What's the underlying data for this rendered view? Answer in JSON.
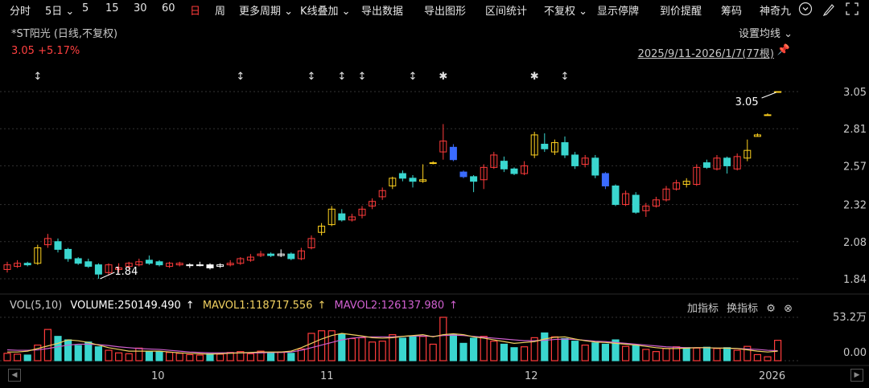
{
  "toolbar": {
    "items": [
      {
        "label": "分时"
      },
      {
        "label": "5日 ⌄"
      },
      {
        "label": "5"
      },
      {
        "label": "15"
      },
      {
        "label": "30"
      },
      {
        "label": "60"
      },
      {
        "label": "日",
        "active": true
      },
      {
        "label": "周"
      },
      {
        "label": "更多周期 ⌄"
      },
      {
        "label": "K线叠加 ⌄"
      },
      {
        "label": "导出数据"
      },
      {
        "label": "导出图形"
      },
      {
        "label": "区间统计"
      },
      {
        "label": "不复权 ⌄"
      },
      {
        "label": "显示停牌"
      },
      {
        "label": "到价提醒"
      },
      {
        "label": "筹码"
      },
      {
        "label": "神奇九"
      }
    ]
  },
  "header": {
    "title": "*ST阳光 (日线,不复权)",
    "price": "3.05 +5.17%",
    "ma_settings": "设置均线 ⌄",
    "range": "2025/9/11-2026/1/7(77根)"
  },
  "price_axis": [
    "3.05",
    "2.81",
    "2.57",
    "2.32",
    "2.08",
    "1.84"
  ],
  "annotations": {
    "high": "3.05",
    "low": "1.84"
  },
  "volume": {
    "name": "VOL(5,10)",
    "volume": "VOLUME:250149.490",
    "mavol1": "MAVOL1:118717.556",
    "mavol2": "MAVOL2:126137.980",
    "buttons": {
      "add": "加指标",
      "switch": "换指标"
    },
    "axis": [
      "53.2万",
      "0.00"
    ]
  },
  "x_labels": [
    "10",
    "11",
    "12",
    "2026"
  ],
  "colors": {
    "up": "#ff3b3b",
    "down": "#3ad6cf",
    "flat": "#ffffff",
    "yellow": "#ffd21f",
    "blue": "#3a6bff",
    "mavol1": "#f0d060",
    "mavol2": "#d060d0",
    "grid": "#333333"
  },
  "markers": [
    "↕",
    "↕",
    "↕",
    "↕",
    "↕",
    "↕",
    "✱",
    "✱",
    "↕"
  ],
  "chart_data": {
    "type": "candlestick",
    "candles": [
      {
        "o": 1.9,
        "c": 1.93,
        "h": 1.95,
        "l": 1.88,
        "v": 0.17
      },
      {
        "o": 1.92,
        "c": 1.94,
        "h": 1.96,
        "l": 1.91,
        "v": 0.15
      },
      {
        "o": 1.94,
        "c": 1.93,
        "h": 1.95,
        "l": 1.92,
        "v": 0.13
      },
      {
        "o": 1.94,
        "c": 2.04,
        "h": 2.06,
        "l": 1.93,
        "v": 0.36
      },
      {
        "o": 2.06,
        "c": 2.1,
        "h": 2.13,
        "l": 2.04,
        "v": 0.72
      },
      {
        "o": 2.08,
        "c": 2.03,
        "h": 2.1,
        "l": 2.01,
        "v": 0.56
      },
      {
        "o": 2.03,
        "c": 1.97,
        "h": 2.04,
        "l": 1.95,
        "v": 0.48
      },
      {
        "o": 1.97,
        "c": 1.94,
        "h": 1.98,
        "l": 1.93,
        "v": 0.35
      },
      {
        "o": 1.95,
        "c": 1.92,
        "h": 1.97,
        "l": 1.91,
        "v": 0.43
      },
      {
        "o": 1.93,
        "c": 1.87,
        "h": 1.94,
        "l": 1.84,
        "v": 0.32
      },
      {
        "o": 1.88,
        "c": 1.93,
        "h": 1.94,
        "l": 1.86,
        "v": 0.24
      },
      {
        "o": 1.9,
        "c": 1.91,
        "h": 1.94,
        "l": 1.88,
        "v": 0.18
      },
      {
        "o": 1.92,
        "c": 1.94,
        "h": 1.95,
        "l": 1.9,
        "v": 0.16
      },
      {
        "o": 1.93,
        "c": 1.95,
        "h": 1.97,
        "l": 1.92,
        "v": 0.29
      },
      {
        "o": 1.96,
        "c": 1.94,
        "h": 1.99,
        "l": 1.93,
        "v": 0.22
      },
      {
        "o": 1.95,
        "c": 1.93,
        "h": 1.96,
        "l": 1.92,
        "v": 0.21
      },
      {
        "o": 1.92,
        "c": 1.94,
        "h": 1.95,
        "l": 1.91,
        "v": 0.19
      },
      {
        "o": 1.93,
        "c": 1.94,
        "h": 1.95,
        "l": 1.92,
        "v": 0.17
      },
      {
        "o": 1.93,
        "c": 1.93,
        "h": 1.94,
        "l": 1.91,
        "v": 0.14
      },
      {
        "o": 1.93,
        "c": 1.93,
        "h": 1.95,
        "l": 1.92,
        "v": 0.13
      },
      {
        "o": 1.93,
        "c": 1.91,
        "h": 1.94,
        "l": 1.9,
        "v": 0.16
      },
      {
        "o": 1.92,
        "c": 1.93,
        "h": 1.94,
        "l": 1.91,
        "v": 0.15
      },
      {
        "o": 1.93,
        "c": 1.94,
        "h": 1.96,
        "l": 1.92,
        "v": 0.19
      },
      {
        "o": 1.94,
        "c": 1.97,
        "h": 1.98,
        "l": 1.93,
        "v": 0.21
      },
      {
        "o": 1.96,
        "c": 1.98,
        "h": 2.0,
        "l": 1.95,
        "v": 0.16
      },
      {
        "o": 1.99,
        "c": 2.0,
        "h": 2.02,
        "l": 1.98,
        "v": 0.22
      },
      {
        "o": 2.0,
        "c": 1.99,
        "h": 2.01,
        "l": 1.98,
        "v": 0.18
      },
      {
        "o": 1.99,
        "c": 2.0,
        "h": 2.03,
        "l": 1.98,
        "v": 0.2
      },
      {
        "o": 2.0,
        "c": 1.97,
        "h": 2.01,
        "l": 1.96,
        "v": 0.17
      },
      {
        "o": 1.97,
        "c": 2.02,
        "h": 2.04,
        "l": 1.96,
        "v": 0.27
      },
      {
        "o": 2.04,
        "c": 2.1,
        "h": 2.12,
        "l": 2.03,
        "v": 0.63
      },
      {
        "o": 2.14,
        "c": 2.18,
        "h": 2.2,
        "l": 2.12,
        "v": 0.69
      },
      {
        "o": 2.19,
        "c": 2.29,
        "h": 2.31,
        "l": 2.18,
        "v": 0.69
      },
      {
        "o": 2.26,
        "c": 2.22,
        "h": 2.29,
        "l": 2.21,
        "v": 0.61
      },
      {
        "o": 2.22,
        "c": 2.24,
        "h": 2.26,
        "l": 2.21,
        "v": 0.51
      },
      {
        "o": 2.25,
        "c": 2.29,
        "h": 2.31,
        "l": 2.23,
        "v": 0.53
      },
      {
        "o": 2.31,
        "c": 2.34,
        "h": 2.36,
        "l": 2.29,
        "v": 0.43
      },
      {
        "o": 2.37,
        "c": 2.41,
        "h": 2.43,
        "l": 2.35,
        "v": 0.45
      },
      {
        "o": 2.44,
        "c": 2.49,
        "h": 2.5,
        "l": 2.42,
        "v": 0.6
      },
      {
        "o": 2.52,
        "c": 2.49,
        "h": 2.54,
        "l": 2.47,
        "v": 0.52
      },
      {
        "o": 2.49,
        "c": 2.47,
        "h": 2.51,
        "l": 2.43,
        "v": 0.57
      },
      {
        "o": 2.47,
        "c": 2.48,
        "h": 2.58,
        "l": 2.46,
        "v": 0.56
      },
      {
        "o": 2.59,
        "c": 2.59,
        "h": 2.6,
        "l": 2.58,
        "v": 0.38
      },
      {
        "o": 2.66,
        "c": 2.73,
        "h": 2.84,
        "l": 2.61,
        "v": 1.0
      },
      {
        "o": 2.69,
        "c": 2.61,
        "h": 2.71,
        "l": 2.6,
        "v": 0.6
      },
      {
        "o": 2.53,
        "c": 2.5,
        "h": 2.54,
        "l": 2.49,
        "v": 0.4
      },
      {
        "o": 2.5,
        "c": 2.47,
        "h": 2.51,
        "l": 2.4,
        "v": 0.52
      },
      {
        "o": 2.48,
        "c": 2.56,
        "h": 2.58,
        "l": 2.42,
        "v": 0.56
      },
      {
        "o": 2.56,
        "c": 2.64,
        "h": 2.66,
        "l": 2.55,
        "v": 0.45
      },
      {
        "o": 2.6,
        "c": 2.55,
        "h": 2.63,
        "l": 2.53,
        "v": 0.38
      },
      {
        "o": 2.55,
        "c": 2.52,
        "h": 2.56,
        "l": 2.51,
        "v": 0.3
      },
      {
        "o": 2.52,
        "c": 2.57,
        "h": 2.6,
        "l": 2.51,
        "v": 0.32
      },
      {
        "o": 2.64,
        "c": 2.77,
        "h": 2.79,
        "l": 2.62,
        "v": 0.53
      },
      {
        "o": 2.71,
        "c": 2.68,
        "h": 2.78,
        "l": 2.66,
        "v": 0.64
      },
      {
        "o": 2.66,
        "c": 2.72,
        "h": 2.74,
        "l": 2.64,
        "v": 0.55
      },
      {
        "o": 2.72,
        "c": 2.64,
        "h": 2.76,
        "l": 2.62,
        "v": 0.51
      },
      {
        "o": 2.64,
        "c": 2.57,
        "h": 2.66,
        "l": 2.55,
        "v": 0.45
      },
      {
        "o": 2.58,
        "c": 2.62,
        "h": 2.64,
        "l": 2.56,
        "v": 0.36
      },
      {
        "o": 2.62,
        "c": 2.51,
        "h": 2.64,
        "l": 2.49,
        "v": 0.41
      },
      {
        "o": 2.52,
        "c": 2.44,
        "h": 2.53,
        "l": 2.42,
        "v": 0.38
      },
      {
        "o": 2.44,
        "c": 2.32,
        "h": 2.45,
        "l": 2.31,
        "v": 0.48
      },
      {
        "o": 2.32,
        "c": 2.39,
        "h": 2.41,
        "l": 2.31,
        "v": 0.33
      },
      {
        "o": 2.38,
        "c": 2.27,
        "h": 2.4,
        "l": 2.26,
        "v": 0.36
      },
      {
        "o": 2.28,
        "c": 2.31,
        "h": 2.33,
        "l": 2.24,
        "v": 0.26
      },
      {
        "o": 2.31,
        "c": 2.35,
        "h": 2.37,
        "l": 2.3,
        "v": 0.21
      },
      {
        "o": 2.35,
        "c": 2.42,
        "h": 2.44,
        "l": 2.34,
        "v": 0.28
      },
      {
        "o": 2.42,
        "c": 2.46,
        "h": 2.48,
        "l": 2.41,
        "v": 0.32
      },
      {
        "o": 2.47,
        "c": 2.45,
        "h": 2.49,
        "l": 2.43,
        "v": 0.3
      },
      {
        "o": 2.45,
        "c": 2.56,
        "h": 2.58,
        "l": 2.44,
        "v": 0.29
      },
      {
        "o": 2.59,
        "c": 2.56,
        "h": 2.61,
        "l": 2.55,
        "v": 0.31
      },
      {
        "o": 2.55,
        "c": 2.62,
        "h": 2.64,
        "l": 2.54,
        "v": 0.28
      },
      {
        "o": 2.62,
        "c": 2.57,
        "h": 2.63,
        "l": 2.52,
        "v": 0.3
      },
      {
        "o": 2.55,
        "c": 2.63,
        "h": 2.65,
        "l": 2.54,
        "v": 0.24
      },
      {
        "o": 2.62,
        "c": 2.67,
        "h": 2.74,
        "l": 2.6,
        "v": 0.33
      },
      {
        "o": 2.76,
        "c": 2.77,
        "h": 2.78,
        "l": 2.76,
        "v": 0.14
      },
      {
        "o": 2.9,
        "c": 2.9,
        "h": 2.91,
        "l": 2.9,
        "v": 0.09
      },
      {
        "o": 3.05,
        "c": 3.05,
        "h": 3.05,
        "l": 3.05,
        "v": 0.47
      }
    ],
    "special": {
      "yellow": [
        3,
        31,
        32,
        38,
        41,
        42,
        52,
        54,
        67,
        73,
        74,
        75,
        76
      ],
      "blue": [
        44,
        45,
        59
      ],
      "flat": [
        18,
        20,
        21,
        27
      ]
    },
    "mavol1": [
      0.2,
      0.2,
      0.22,
      0.28,
      0.34,
      0.4,
      0.48,
      0.46,
      0.42,
      0.36,
      0.3,
      0.26,
      0.22,
      0.22,
      0.22,
      0.22,
      0.2,
      0.18,
      0.17,
      0.16,
      0.15,
      0.16,
      0.17,
      0.18,
      0.19,
      0.2,
      0.2,
      0.2,
      0.22,
      0.3,
      0.4,
      0.5,
      0.58,
      0.63,
      0.6,
      0.57,
      0.53,
      0.52,
      0.53,
      0.56,
      0.58,
      0.6,
      0.55,
      0.6,
      0.62,
      0.6,
      0.55,
      0.52,
      0.48,
      0.44,
      0.4,
      0.42,
      0.44,
      0.5,
      0.54,
      0.55,
      0.5,
      0.46,
      0.43,
      0.42,
      0.4,
      0.38,
      0.36,
      0.33,
      0.3,
      0.28,
      0.28,
      0.29,
      0.3,
      0.3,
      0.29,
      0.29,
      0.28,
      0.25,
      0.22,
      0.2,
      0.22
    ],
    "mavol2": [
      0.25,
      0.24,
      0.24,
      0.25,
      0.28,
      0.32,
      0.36,
      0.38,
      0.38,
      0.37,
      0.35,
      0.32,
      0.3,
      0.28,
      0.27,
      0.26,
      0.24,
      0.22,
      0.2,
      0.19,
      0.18,
      0.18,
      0.18,
      0.18,
      0.18,
      0.18,
      0.19,
      0.19,
      0.2,
      0.24,
      0.3,
      0.36,
      0.42,
      0.48,
      0.52,
      0.54,
      0.55,
      0.55,
      0.55,
      0.56,
      0.57,
      0.57,
      0.56,
      0.58,
      0.59,
      0.58,
      0.56,
      0.54,
      0.52,
      0.5,
      0.48,
      0.46,
      0.46,
      0.47,
      0.49,
      0.5,
      0.49,
      0.47,
      0.45,
      0.44,
      0.42,
      0.4,
      0.38,
      0.36,
      0.34,
      0.32,
      0.31,
      0.3,
      0.3,
      0.3,
      0.29,
      0.29,
      0.28,
      0.27,
      0.26,
      0.24,
      0.23
    ]
  }
}
